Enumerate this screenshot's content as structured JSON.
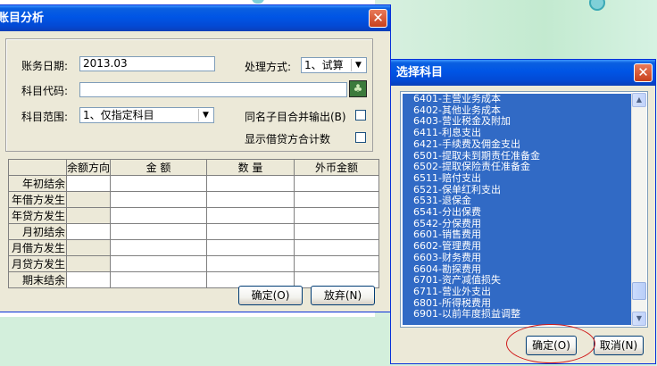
{
  "main_dialog": {
    "title": "账目分析",
    "labels": {
      "date": "账务日期:",
      "method": "处理方式:",
      "code": "科目代码:",
      "range": "科目范围:",
      "merge": "同名子目合并输出(B)",
      "show_total": "显示借贷方合计数"
    },
    "date_value": "2013.03",
    "method_value": "1、试算",
    "code_value": "",
    "range_value": "1、仅指定科目",
    "table": {
      "headers": [
        "",
        "余额方向",
        "金  额",
        "数  量",
        "外币金额"
      ],
      "rows": [
        "年初结余",
        "年借方发生",
        "年贷方发生",
        "月初结余",
        "月借方发生",
        "月贷方发生",
        "期末结余"
      ]
    },
    "buttons": {
      "ok": "确定(O)",
      "cancel": "放弃(N)"
    }
  },
  "select_dialog": {
    "title": "选择科目",
    "items": [
      "6401-主营业务成本",
      "6402-其他业务成本",
      "6403-营业税金及附加",
      "6411-利息支出",
      "6421-手续费及佣金支出",
      "6501-提取未到期责任准备金",
      "6502-提取保险责任准备金",
      "6511-赔付支出",
      "6521-保单红利支出",
      "6531-退保金",
      "6541-分出保费",
      "6542-分保费用",
      "6601-销售费用",
      "6602-管理费用",
      "6603-财务费用",
      "6604-勘探费用",
      "6701-资产减值损失",
      "6711-营业外支出",
      "6801-所得税费用",
      "6901-以前年度损益调整"
    ],
    "buttons": {
      "ok": "确定(O)",
      "cancel": "取消(N)"
    }
  }
}
